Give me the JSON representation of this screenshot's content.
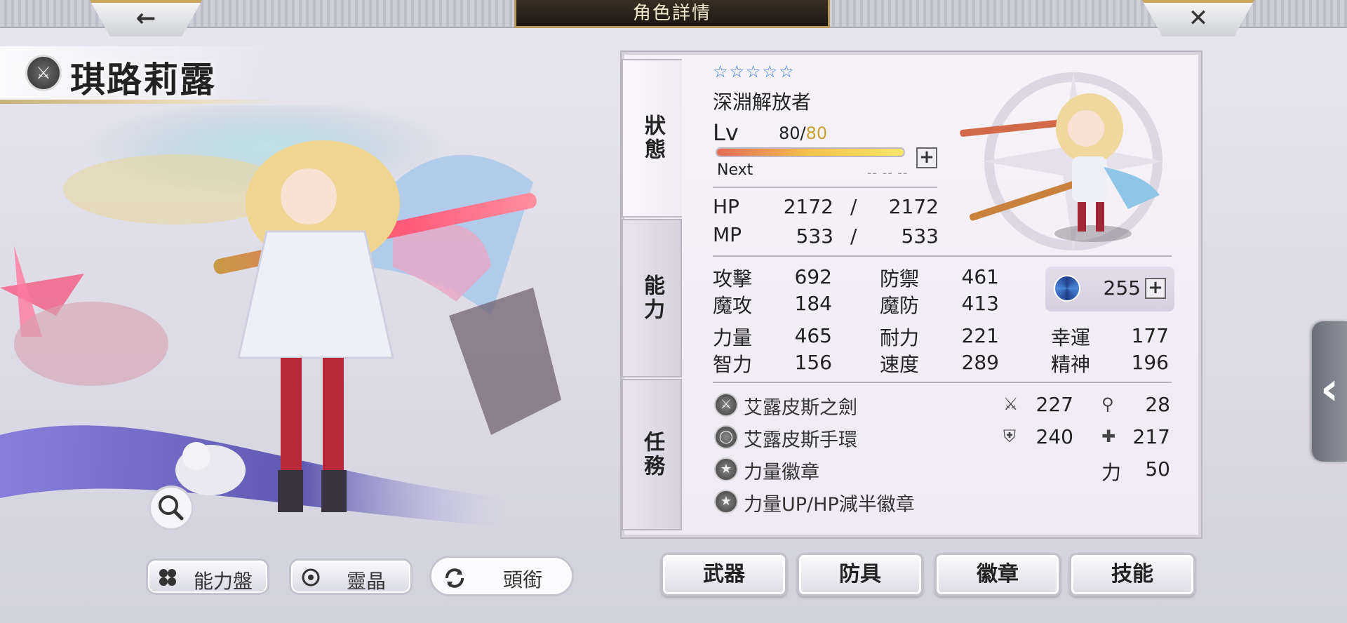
{
  "header": {
    "title": "角色詳情",
    "back_icon": "back-arrow-icon",
    "close_icon": "close-icon"
  },
  "character": {
    "name": "琪路莉露",
    "weapon_type_icon": "sword-icon"
  },
  "left_buttons": [
    {
      "label": "能力盤",
      "icon": "ability-board-icon"
    },
    {
      "label": "靈晶",
      "icon": "crystal-icon"
    },
    {
      "label": "頭銜",
      "icon": "refresh-icon"
    }
  ],
  "tabs": [
    "狀態",
    "能力",
    "任務"
  ],
  "status": {
    "rarity_stars": 5,
    "job": "深淵解放者",
    "level_label": "Lv",
    "level": "80",
    "level_sep": "/",
    "level_max": "80",
    "exp_progress": 1.0,
    "next_label": "Next",
    "next_value": "-- -- --",
    "hp_label": "HP",
    "hp": "2172",
    "hp_sep": "/",
    "hp_max": "2172",
    "mp_label": "MP",
    "mp": "533",
    "mp_sep": "/",
    "mp_max": "533"
  },
  "stats": {
    "atk_label": "攻擊",
    "atk": "692",
    "def_label": "防禦",
    "def": "461",
    "matk_label": "魔攻",
    "matk": "184",
    "mdef_label": "魔防",
    "mdef": "413",
    "str_label": "力量",
    "str": "465",
    "vit_label": "耐力",
    "vit": "221",
    "luck_label": "幸運",
    "luck": "177",
    "int_label": "智力",
    "int": "156",
    "spd_label": "速度",
    "spd": "289",
    "spi_label": "精神",
    "spi": "196",
    "spirit_value": "255"
  },
  "equipment": [
    {
      "name": "艾露皮斯之劍",
      "icon": "sword-icon"
    },
    {
      "name": "艾露皮斯手環",
      "icon": "bracelet-icon"
    },
    {
      "name": "力量徽章",
      "icon": "badge-icon"
    },
    {
      "name": "力量UP/HP減半徽章",
      "icon": "badge-icon"
    }
  ],
  "equip_stats": {
    "patk_icon": "sword-stat-icon",
    "patk": "227",
    "matk_icon": "wand-stat-icon",
    "matk": "28",
    "pdef_icon": "shield-stat-icon",
    "pdef": "240",
    "mdef_icon": "magic-shield-stat-icon",
    "mdef": "217",
    "str_label": "力",
    "str": "50"
  },
  "bottom_buttons": [
    "武器",
    "防具",
    "徽章",
    "技能"
  ],
  "colors": {
    "accent_gold": "#c9a233",
    "panel_bg": "#f3eff6",
    "spirit_blue": "#2f5fb8"
  }
}
